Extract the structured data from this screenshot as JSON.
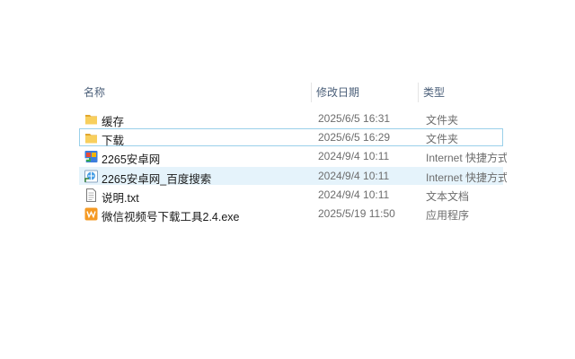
{
  "columns": [
    {
      "label": "名称"
    },
    {
      "label": "修改日期"
    },
    {
      "label": "类型"
    }
  ],
  "files": [
    {
      "name": "缓存",
      "date": "2025/6/5 16:31",
      "type": "文件夹",
      "icon": "folder-icon"
    },
    {
      "name": "下载",
      "date": "2025/6/5 16:29",
      "type": "文件夹",
      "icon": "folder-icon"
    },
    {
      "name": "2265安卓网",
      "date": "2024/9/4 10:11",
      "type": "Internet 快捷方式",
      "icon": "internet-shortcut-icon"
    },
    {
      "name": "2265安卓网_百度搜索",
      "date": "2024/9/4 10:11",
      "type": "Internet 快捷方式",
      "icon": "internet-shortcut-icon"
    },
    {
      "name": "说明.txt",
      "date": "2024/9/4 10:11",
      "type": "文本文档",
      "icon": "text-document-icon"
    },
    {
      "name": "微信视频号下载工具2.4.exe",
      "date": "2025/5/19 11:50",
      "type": "应用程序",
      "icon": "application-icon"
    }
  ],
  "colors": {
    "folder": "#f5c64a",
    "selection_border": "#9ad0ea",
    "hover": "#e5f3fb"
  }
}
